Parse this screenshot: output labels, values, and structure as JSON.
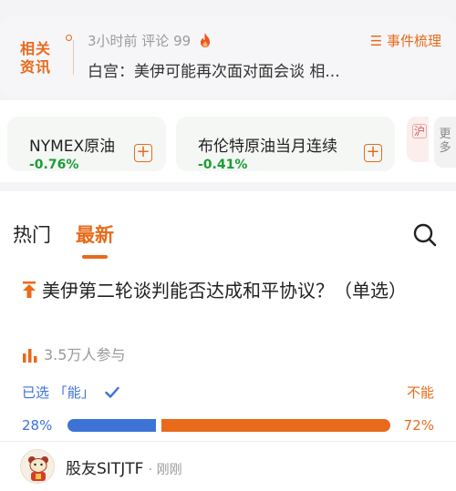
{
  "news": {
    "logo_line1": "相关",
    "logo_line2": "资讯",
    "meta": "3小时前 评论 99",
    "events_label": "☰ 事件梳理",
    "headline": "白宫：美伊可能再次面对面会谈 相..."
  },
  "quotes": [
    {
      "name": "NYMEX原油",
      "change": "-0.76%"
    },
    {
      "name": "布伦特原油当月连续",
      "change": "-0.41%"
    }
  ],
  "quote_partial": "沪",
  "more_label": "更多",
  "tabs": {
    "hot": "热门",
    "latest": "最新"
  },
  "poll": {
    "title": "美伊第二轮谈判能否达成和平协议？（单选）",
    "participants": "3.5万人参与",
    "option_a": "已选 「能」",
    "option_b": "不能",
    "pct_a_label": "28%",
    "pct_b_label": "72%",
    "pct_a": 28,
    "pct_b": 72
  },
  "user": {
    "name": "股友SITJTF",
    "time": "· 刚刚"
  },
  "colors": {
    "accent": "#e86a1b",
    "blue": "#3d73d6",
    "green": "#1a9e38"
  }
}
